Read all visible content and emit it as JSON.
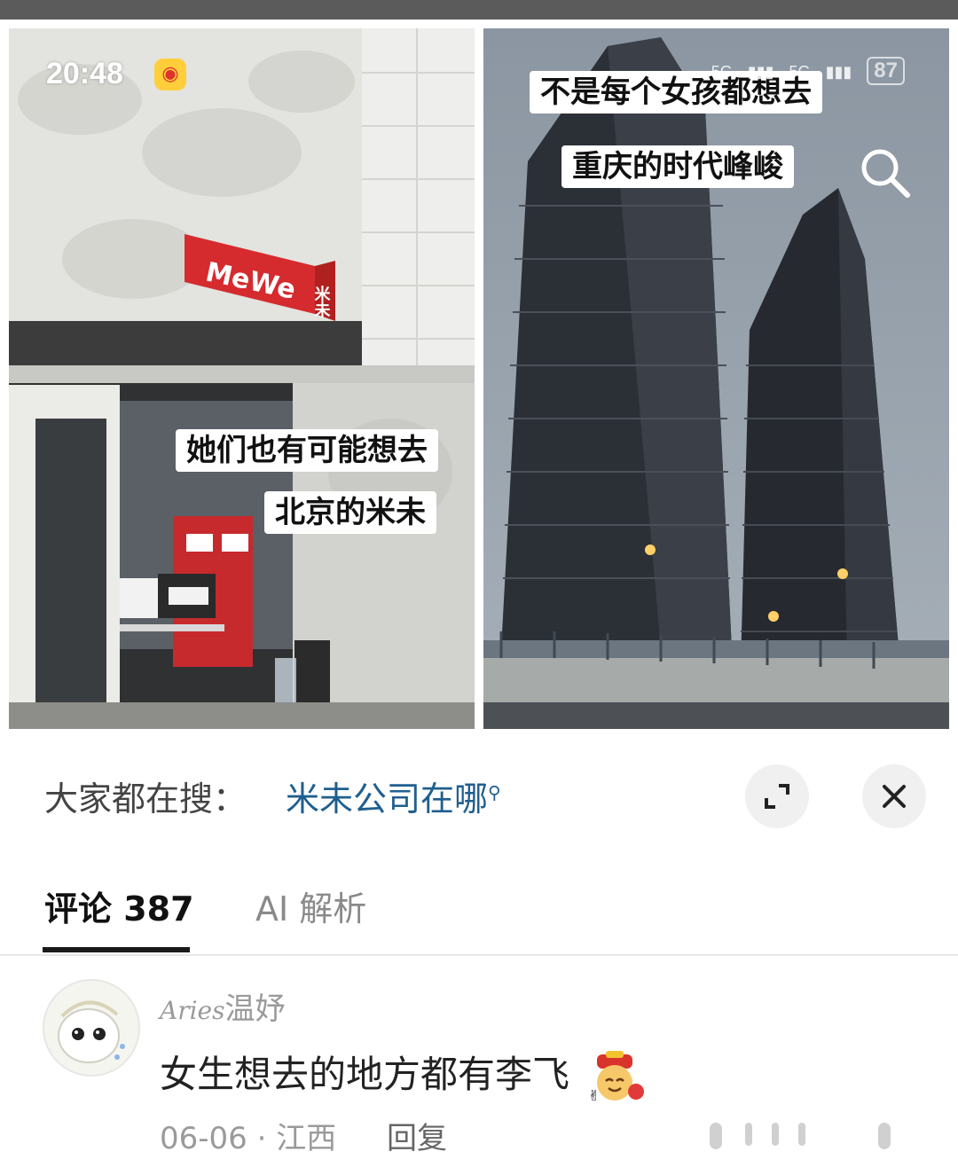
{
  "status_bar": {
    "time": "20:48",
    "network": [
      "5G",
      "5G"
    ],
    "battery": "87"
  },
  "images": {
    "left": {
      "sign_text": "MeWe",
      "sign_side": "米未",
      "caption_line1": "她们也有可能想去",
      "caption_line2": "北京的米未"
    },
    "right": {
      "caption_line1": "不是每个女孩都想去",
      "caption_line2": "重庆的时代峰峻"
    }
  },
  "search_suggestion": {
    "label": "大家都在搜：",
    "query": "米未公司在哪"
  },
  "tabs": {
    "comments_label": "评论 387",
    "ai_label": "AI 解析"
  },
  "comment": {
    "username_script": "Aries",
    "username": "温妤",
    "text": "女生想去的地方都有李飞",
    "date_location": "06-06 · 江西",
    "reply_label": "回复"
  },
  "colors": {
    "link": "#1f5f8f",
    "sign_red": "#d52b2f"
  }
}
